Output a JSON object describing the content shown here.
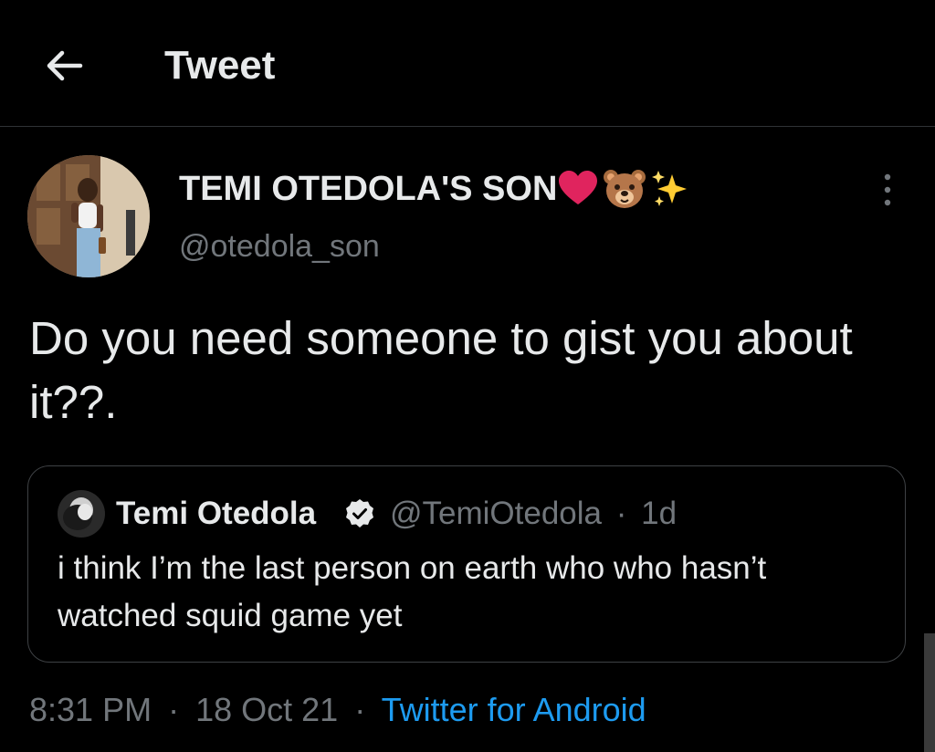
{
  "header": {
    "back_icon": "arrow-left-icon",
    "title": "Tweet"
  },
  "tweet": {
    "author_name": "TEMI OTEDOLA'S SON",
    "author_name_emojis": [
      "red-heart",
      "bear-face",
      "sparkles"
    ],
    "author_handle": "@otedola_son",
    "more_icon": "vertical-ellipsis-icon",
    "text": "Do you need someone to gist you about it??.",
    "quote": {
      "author_name": "Temi Otedola",
      "verified_icon": "verified-badge-icon",
      "author_handle": "@TemiOtedola",
      "separator": "·",
      "age": "1d",
      "text": "i think I’m the last person on earth who who hasn’t watched squid game yet"
    },
    "time": "8:31 PM",
    "date": "18 Oct 21",
    "separator": "·",
    "source": "Twitter for Android"
  },
  "colors": {
    "background": "#000000",
    "text_primary": "#e7e9ea",
    "text_secondary": "#71767b",
    "link": "#1d9bf0",
    "heart": "#e0245e",
    "border": "#2f3336"
  }
}
